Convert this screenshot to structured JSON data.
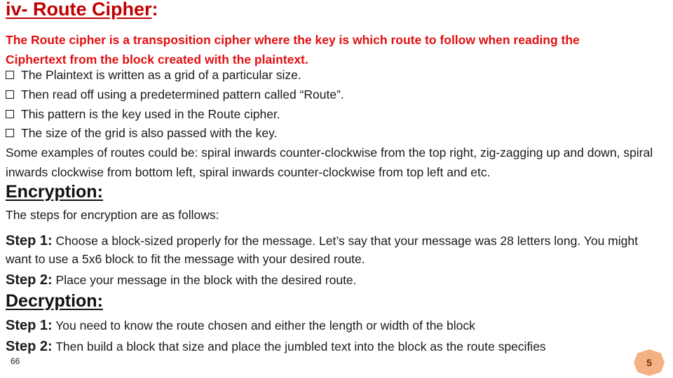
{
  "title": {
    "main": "iv- Route Cipher",
    "colon": ":"
  },
  "intro": "The Route cipher is a transposition cipher where the key is which route to follow when reading the Ciphertext from the block created with the plaintext.",
  "bullets": [
    "The Plaintext is written as a grid of a particular size.",
    "Then read off using a predetermined pattern called “Route”.",
    "This pattern is the key used in the Route cipher.",
    "The size of the grid is also passed with the key."
  ],
  "examples": " Some examples of routes could be: spiral inwards counter-clockwise from the top right, zig-zagging up and down,  spiral inwards clockwise from bottom left, spiral inwards counter-clockwise from top left and etc.",
  "encryption": {
    "heading": "Encryption:",
    "lead": "The steps for encryption are as follows:",
    "steps": [
      {
        "label": "Step 1:",
        "text": " Choose a block-sized properly for the message. Let’s say that your message was 28 letters long. You might want to use a 5x6 block to fit the message with your desired route."
      },
      {
        "label": "Step 2:",
        "text": " Place your message in the block with the desired route."
      }
    ]
  },
  "decryption": {
    "heading": "Decryption:",
    "steps": [
      {
        "label": "Step 1:",
        "text": " You need to know the route chosen and either the length or width of the block"
      },
      {
        "label": "Step 2:",
        "text": " Then build a block that size and place the jumbled text into the block as the route specifies"
      }
    ]
  },
  "footer": {
    "page_number": "66",
    "badge_number": "5"
  },
  "colors": {
    "title": "#c00000",
    "intro": "#e01010",
    "badge_fill": "#f4b183"
  }
}
